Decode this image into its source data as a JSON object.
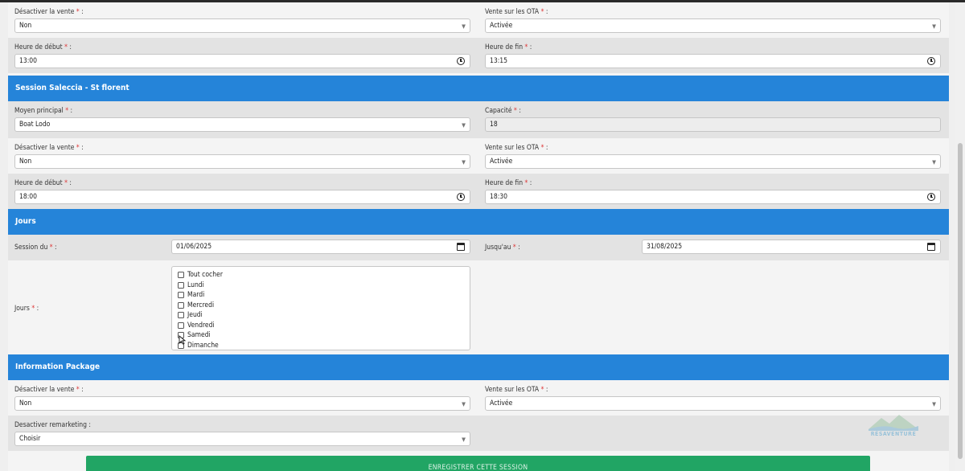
{
  "row_top": {
    "left": {
      "label": "Désactiver la vente",
      "value": "Non"
    },
    "right": {
      "label": "Vente sur les OTA",
      "value": "Activée"
    }
  },
  "row_hours1": {
    "left": {
      "label": "Heure de début",
      "value": "13:00"
    },
    "right": {
      "label": "Heure de fin",
      "value": "13:15"
    }
  },
  "session_section": {
    "title": "Session Saleccia - St florent",
    "moyen": {
      "label": "Moyen principal",
      "value": "Boat Lodo"
    },
    "capacite": {
      "label": "Capacité",
      "value": "18"
    },
    "desactiver": {
      "label": "Désactiver la vente",
      "value": "Non"
    },
    "ota": {
      "label": "Vente sur les OTA",
      "value": "Activée"
    },
    "debut": {
      "label": "Heure de début",
      "value": "18:00"
    },
    "fin": {
      "label": "Heure de fin",
      "value": "18:30"
    }
  },
  "jours_section": {
    "title": "Jours",
    "session_du": {
      "label": "Session du",
      "value": "01/06/2025"
    },
    "jusquau": {
      "label": "Jusqu'au",
      "value": "31/08/2025"
    },
    "jours_label": "Jours",
    "days": [
      "Tout cocher",
      "Lundi",
      "Mardi",
      "Mercredi",
      "Jeudi",
      "Vendredi",
      "Samedi",
      "Dimanche"
    ]
  },
  "package_section": {
    "title": "Information Package",
    "desactiver": {
      "label": "Désactiver la vente",
      "value": "Non"
    },
    "ota": {
      "label": "Vente sur les OTA",
      "value": "Activée"
    },
    "remarketing": {
      "label": "Desactiver remarketing :",
      "value": "Choisir"
    }
  },
  "required_mark": "*",
  "colon": ":",
  "logo_text": "RÉSAVENTURE",
  "save_label": "ENREGISTRER CETTE SESSION",
  "colors": {
    "section": "#2584d9",
    "save": "#21a564",
    "required": "#d33333"
  }
}
